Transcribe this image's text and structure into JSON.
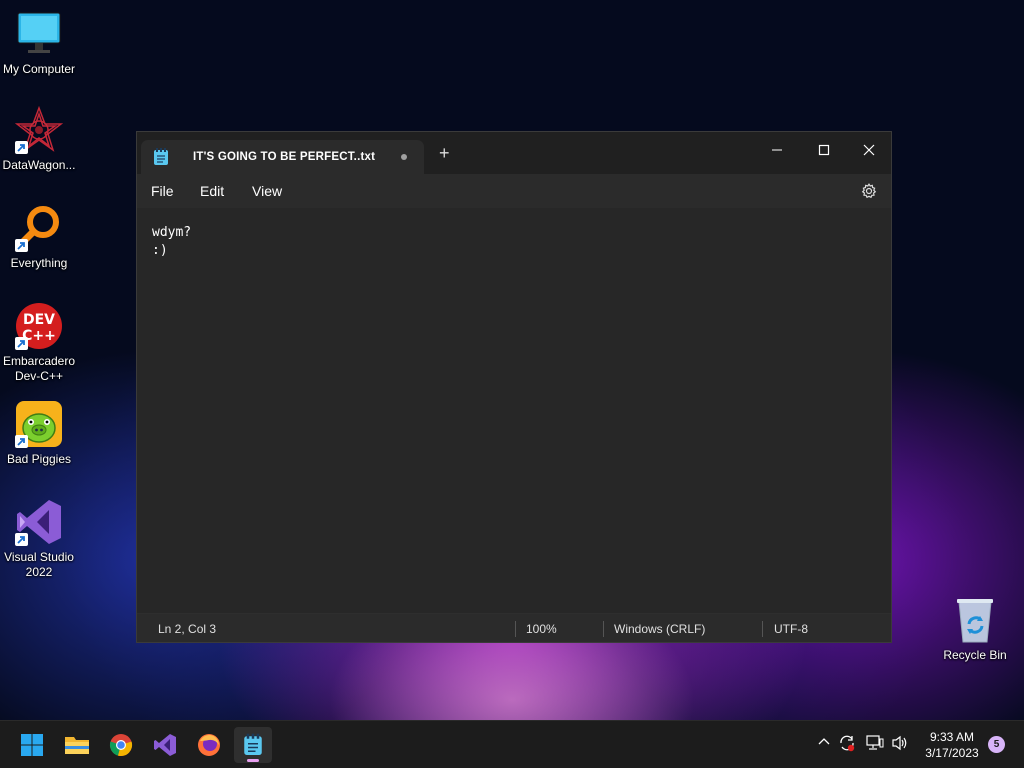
{
  "desktop": {
    "icons": [
      {
        "label": "My Computer",
        "icon": "monitor-icon"
      },
      {
        "label": "DataWagon...",
        "icon": "datawagon-icon"
      },
      {
        "label": "Everything",
        "icon": "magnifier-icon"
      },
      {
        "label": "Embarcadero\nDev-C++",
        "icon": "devcpp-icon"
      },
      {
        "label": "Bad Piggies",
        "icon": "pig-icon"
      },
      {
        "label": "Visual Studio\n2022",
        "icon": "visual-studio-icon"
      },
      {
        "label": "Recycle Bin",
        "icon": "recycle-bin-icon"
      }
    ],
    "devcpp_text": {
      "line1": "DEV",
      "line2": "C++"
    }
  },
  "notepad": {
    "tab_title": "IT'S GOING TO BE PERFECT..txt",
    "new_tab": "+",
    "menu": {
      "file": "File",
      "edit": "Edit",
      "view": "View"
    },
    "content_lines": [
      "wdym?",
      ":)"
    ],
    "status": {
      "position": "Ln 2, Col 3",
      "zoom": "100%",
      "line_ending": "Windows (CRLF)",
      "encoding": "UTF-8"
    }
  },
  "taskbar": {
    "time": "9:33 AM",
    "date": "3/17/2023",
    "notification_count": "5",
    "accent": "#e8a0f0"
  }
}
